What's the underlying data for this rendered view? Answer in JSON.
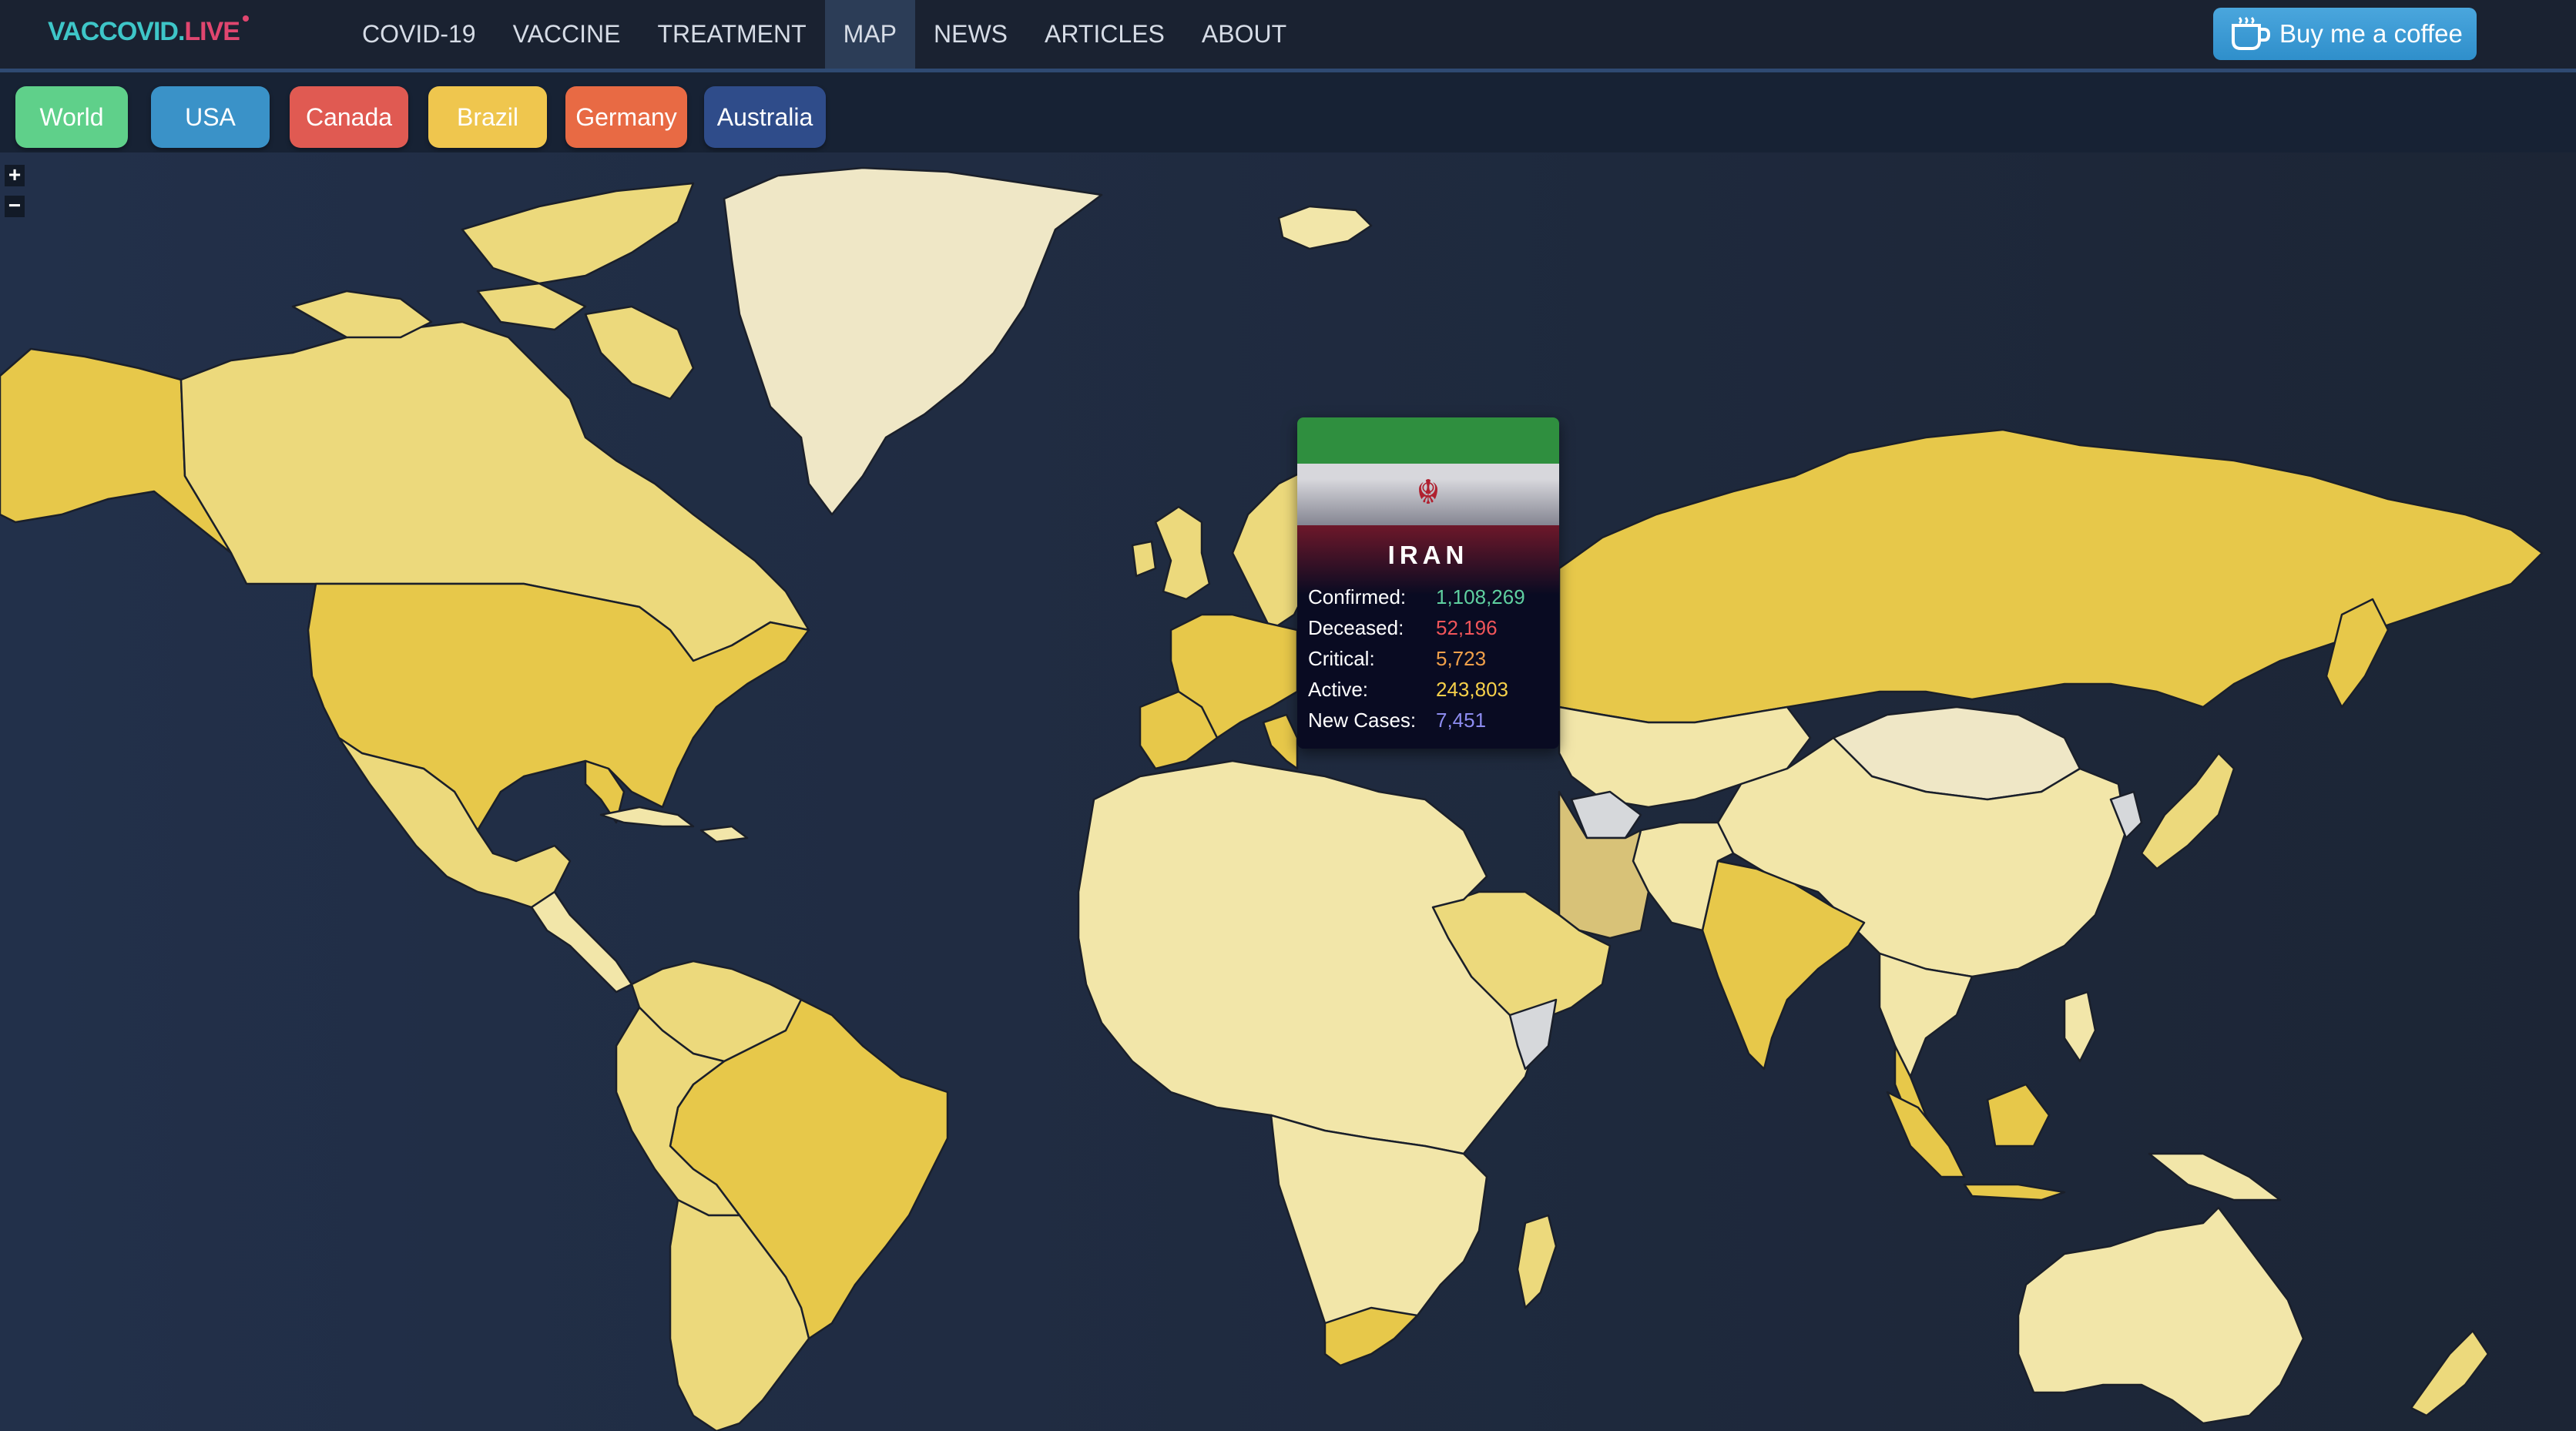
{
  "brand": {
    "part1": "VACCOVID.",
    "part2": "LIVE"
  },
  "nav": {
    "items": [
      {
        "label": "COVID-19",
        "active": false
      },
      {
        "label": "VACCINE",
        "active": false
      },
      {
        "label": "TREATMENT",
        "active": false
      },
      {
        "label": "MAP",
        "active": true
      },
      {
        "label": "NEWS",
        "active": false
      },
      {
        "label": "ARTICLES",
        "active": false
      },
      {
        "label": "ABOUT",
        "active": false
      }
    ]
  },
  "coffee_button": {
    "label": "Buy me a coffee",
    "icon": "coffee-cup-icon"
  },
  "regions": [
    {
      "label": "World",
      "color": "#5fd08a"
    },
    {
      "label": "USA",
      "color": "#3a92c8"
    },
    {
      "label": "Canada",
      "color": "#e05a52"
    },
    {
      "label": "Brazil",
      "color": "#efc64e"
    },
    {
      "label": "Germany",
      "color": "#e86a44"
    },
    {
      "label": "Australia",
      "color": "#2f4c8a"
    }
  ],
  "zoom": {
    "in": "+",
    "out": "−"
  },
  "map": {
    "background": "#1f2b3e",
    "fill_high": "#e7c84a",
    "fill_mid": "#ecd97c",
    "fill_low": "#f2e6a9",
    "fill_none": "#d6d8db"
  },
  "tooltip": {
    "country": "IRAN",
    "rows": [
      {
        "label": "Confirmed:",
        "value": "1,108,269",
        "color": "#5fd0a0"
      },
      {
        "label": "Deceased:",
        "value": "52,196",
        "color": "#f0555a"
      },
      {
        "label": "Critical:",
        "value": "5,723",
        "color": "#f0a04a"
      },
      {
        "label": "Active:",
        "value": "243,803",
        "color": "#f6d04a"
      },
      {
        "label": "New Cases:",
        "value": "7,451",
        "color": "#8d8cf0"
      }
    ]
  }
}
